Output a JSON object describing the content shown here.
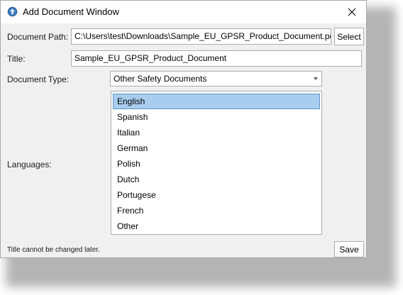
{
  "window": {
    "title": "Add Document Window",
    "close_icon": "close-icon",
    "app_icon": "upload-arrow-icon"
  },
  "form": {
    "document_path_label": "Document Path:",
    "document_path_value": "C:\\Users\\test\\Downloads\\Sample_EU_GPSR_Product_Document.pdf",
    "select_button": "Select",
    "title_label": "Title:",
    "title_value": "Sample_EU_GPSR_Product_Document",
    "document_type_label": "Document Type:",
    "document_type_value": "Other Safety Documents",
    "languages_label": "Languages:",
    "languages": [
      "English",
      "Spanish",
      "Italian",
      "German",
      "Polish",
      "Dutch",
      "Portugese",
      "French",
      "Other"
    ],
    "selected_language": "English"
  },
  "footer": {
    "note": "Title cannot be changed later.",
    "save_button": "Save"
  },
  "colors": {
    "selection_bg": "#a9cdee",
    "selection_border": "#5c94c6",
    "app_icon_blue": "#2b5f9e"
  }
}
